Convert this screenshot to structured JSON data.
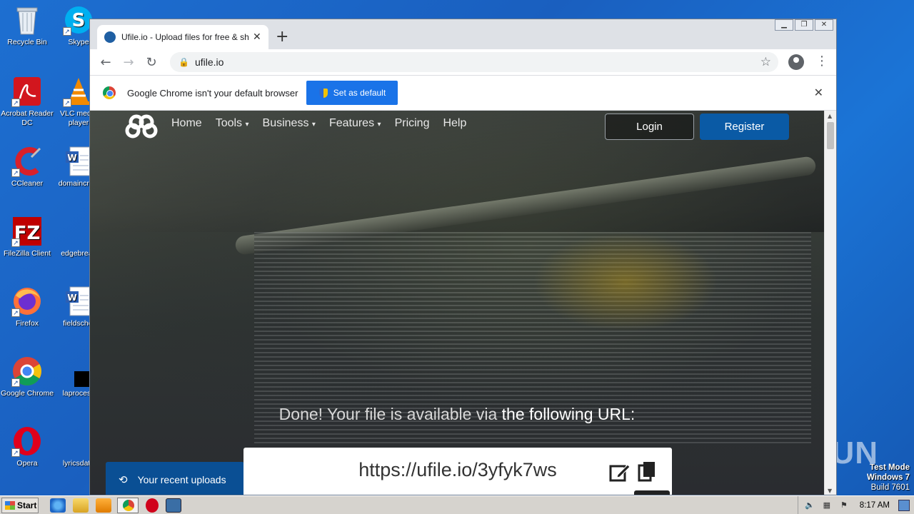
{
  "desktop": {
    "icons": [
      {
        "label": "Recycle Bin"
      },
      {
        "label": "Skype"
      },
      {
        "label": "Acrobat Reader DC"
      },
      {
        "label": "VLC media player"
      },
      {
        "label": "CCleaner"
      },
      {
        "label": "domaincrow"
      },
      {
        "label": "FileZilla Client"
      },
      {
        "label": "edgebreak"
      },
      {
        "label": "Firefox"
      },
      {
        "label": "fieldschoi"
      },
      {
        "label": "Google Chrome"
      },
      {
        "label": "laprocess"
      },
      {
        "label": "Opera"
      },
      {
        "label": "lyricsdate"
      }
    ],
    "watermark": "ANY RUN",
    "test_mode": {
      "line1": "Test Mode",
      "line2": "Windows 7",
      "line3": "Build 7601"
    }
  },
  "browser": {
    "tab_title": "Ufile.io - Upload files for free & share",
    "url": "ufile.io",
    "infobar": {
      "message": "Google Chrome isn't your default browser",
      "button": "Set as default"
    }
  },
  "site": {
    "nav": [
      "Home",
      "Tools",
      "Business",
      "Features",
      "Pricing",
      "Help"
    ],
    "login": "Login",
    "register": "Register",
    "done_prefix": "Done! Your file is available via ",
    "done_emph": "the following URL:",
    "file_url": "https://ufile.io/3yfyk7ws",
    "recent_uploads": "Your recent uploads"
  },
  "taskbar": {
    "start": "Start",
    "clock": "8:17 AM"
  }
}
